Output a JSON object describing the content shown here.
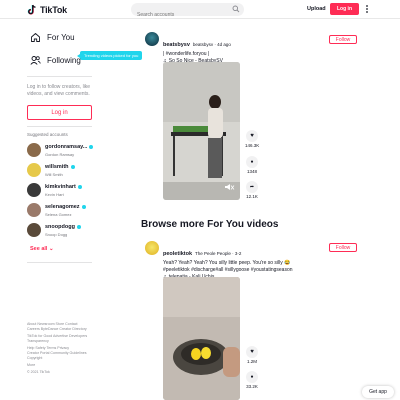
{
  "header": {
    "logo_text": "TikTok",
    "search_placeholder": "Search accounts",
    "upload_label": "Upload",
    "login_label": "Log in"
  },
  "sidebar": {
    "nav": [
      {
        "label": "For You",
        "icon": "home-icon"
      },
      {
        "label": "Following",
        "icon": "users-icon"
      }
    ],
    "tooltip": "Trending videos picked for you",
    "login_prompt": "Log in to follow creators, like videos, and view comments.",
    "login_button": "Log in",
    "suggested_title": "Suggested accounts",
    "accounts": [
      {
        "username": "gordonramsay...",
        "name": "Gordon Ramsay",
        "color": "#8a6a4a"
      },
      {
        "username": "willsmith",
        "name": "Will Smith",
        "color": "#e6c94a"
      },
      {
        "username": "kimkvinhart",
        "name": "Kevin Hart",
        "color": "#3a3a3a"
      },
      {
        "username": "selenagomez",
        "name": "Selena Gomez",
        "color": "#9a7a6a"
      },
      {
        "username": "snoopdogg",
        "name": "Snoop Dogg",
        "color": "#5a4a3a"
      }
    ],
    "see_all": "See all",
    "footer": [
      "About  Newsroom  Store  Contact",
      "Careers  ByteDance  Creator Directory",
      "TikTok for Good  Advertise  Developers",
      "Transparency",
      "Help  Safety  Terms  Privacy",
      "Creator Portal  Community Guidelines",
      "Copyright",
      "More",
      "© 2021 TikTok"
    ]
  },
  "posts": [
    {
      "username": "beatsbysv",
      "meta": "beatsbysv · 4d ago",
      "caption": "| #wonderlife.foryou |",
      "music": "So So Nice - BeatsbySV",
      "follow": "Follow",
      "likes": "146.3K",
      "comments": "1348",
      "shares": "12.1K"
    },
    {
      "username": "peoletiktok",
      "meta": "The Peole People · 3-2",
      "caption": "Yeah? Yeah? Yeah? You silly little peep. You're so silly 😂 #peeletiktok #discharge#all #sillygoose #youstatingseason",
      "music": "telepatia - Kali Uchis",
      "follow": "Follow",
      "likes": "1.2M",
      "comments": "33.2K"
    }
  ],
  "browse_title": "Browse more For You videos",
  "get_app": "Get app",
  "colors": {
    "accent": "#fe2c55",
    "tooltip": "#20d5ec"
  }
}
